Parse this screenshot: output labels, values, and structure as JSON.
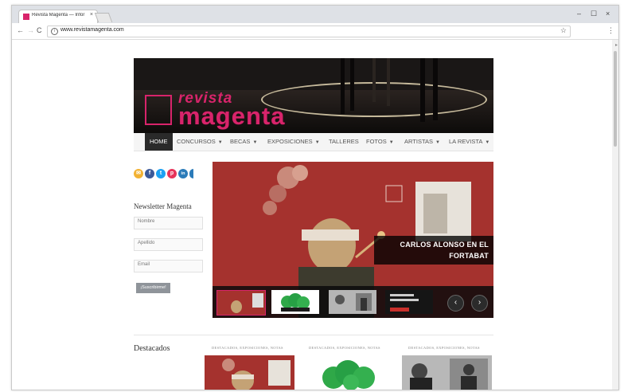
{
  "browser": {
    "tab_title": "Revista Magenta — Infor",
    "tab_close": "×",
    "url": "www.revistamagenta.com",
    "window_controls": [
      "–",
      "☐",
      "×"
    ],
    "info_icon": "i",
    "star_icon": "☆",
    "menu_icon": "⋮"
  },
  "nav": {
    "items": [
      {
        "label": "HOME",
        "active": true
      },
      {
        "label": "CONCURSOS",
        "dropdown": true
      },
      {
        "label": "BECAS",
        "dropdown": true
      },
      {
        "label": "EXPOSICIONES",
        "dropdown": true
      },
      {
        "label": "TALLERES",
        "dropdown": false
      },
      {
        "label": "FOTOS",
        "dropdown": true
      },
      {
        "label": "ARTISTAS",
        "dropdown": true
      },
      {
        "label": "LA REVISTA",
        "dropdown": true
      }
    ]
  },
  "logo": {
    "line1": "revista",
    "line2": "magenta"
  },
  "social": [
    {
      "name": "email-icon",
      "glyph": "✉",
      "color": "#f2b233"
    },
    {
      "name": "facebook-icon",
      "glyph": "f",
      "color": "#3b5998"
    },
    {
      "name": "twitter-icon",
      "glyph": "t",
      "color": "#1da1f2"
    },
    {
      "name": "pinterest-icon",
      "glyph": "p",
      "color": "#e7335a"
    },
    {
      "name": "linkedin-icon",
      "glyph": "in",
      "color": "#2b7bb9"
    }
  ],
  "newsletter": {
    "title": "Newsletter Magenta",
    "nombre_placeholder": "Nombre",
    "apellido_placeholder": "Apellido",
    "email_placeholder": "Email",
    "button_label": "¡Suscribirme!"
  },
  "slider": {
    "caption": "CARLOS ALONSO EN EL FORTABAT",
    "prev": "‹",
    "next": "›"
  },
  "destacados": {
    "title": "Destacados",
    "cards": [
      {
        "category": "DESTACADOS, EXPOSICIONES, NOTAS"
      },
      {
        "category": "DESTACADOS, EXPOSICIONES, NOTAS"
      },
      {
        "category": "DESTACADOS, EXPOSICIONES, NOTAS"
      }
    ]
  },
  "colors": {
    "brand": "#d8246b",
    "nav_active": "#2a2a2a"
  }
}
